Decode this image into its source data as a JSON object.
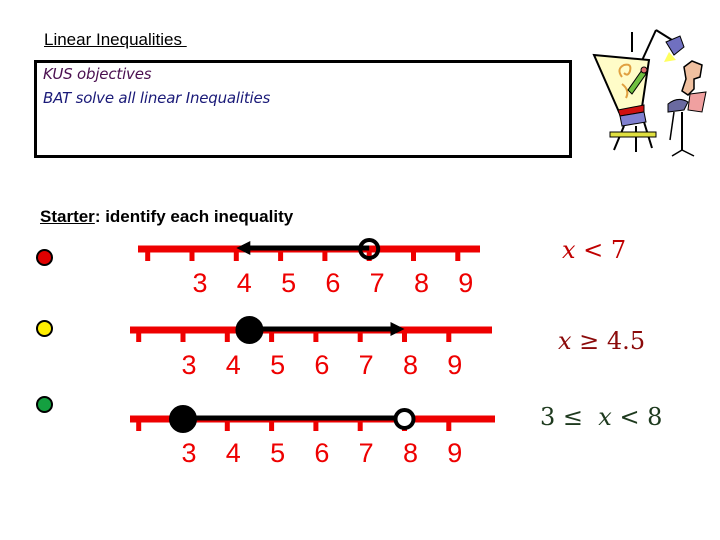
{
  "header": {
    "title": "Linear Inequalities ",
    "objectives": [
      "KUS objectives",
      "BAT solve all linear Inequalities"
    ]
  },
  "starter": {
    "label": "Starter",
    "rest": ": identify each inequality"
  },
  "difficulty_dots": [
    {
      "name": "red",
      "color": "#e00000"
    },
    {
      "name": "yellow",
      "color": "#ffee00"
    },
    {
      "name": "green",
      "color": "#14a040"
    }
  ],
  "number_lines": [
    {
      "tick_labels": [
        "3",
        "4",
        "5",
        "6",
        "7",
        "8",
        "9"
      ],
      "start": {
        "value": 7,
        "filled": false
      },
      "end": {
        "value": 4,
        "arrow": true
      },
      "answer": {
        "var": "x",
        "text": " < 7",
        "prefix": "",
        "color": "#c00000"
      }
    },
    {
      "tick_labels": [
        "3",
        "4",
        "5",
        "6",
        "7",
        "8",
        "9"
      ],
      "start": {
        "value": 4.5,
        "filled": true
      },
      "end": {
        "value": 8,
        "arrow": true
      },
      "answer": {
        "var": "x",
        "text": " ≥ 4.5",
        "prefix": "",
        "color": "#8b0a0a"
      }
    },
    {
      "tick_labels": [
        "3",
        "4",
        "5",
        "6",
        "7",
        "8",
        "9"
      ],
      "start": {
        "value": 3,
        "filled": true
      },
      "end": {
        "value": 8,
        "filled": false
      },
      "answer": {
        "var": "x",
        "text": " < 8",
        "prefix": "3 ≤  ",
        "color": "#1e3a1e"
      }
    }
  ],
  "colors": {
    "number_line": "#ee0000",
    "solution": "#000000"
  },
  "illustration": {
    "icon": "artist-at-easel-icon"
  }
}
